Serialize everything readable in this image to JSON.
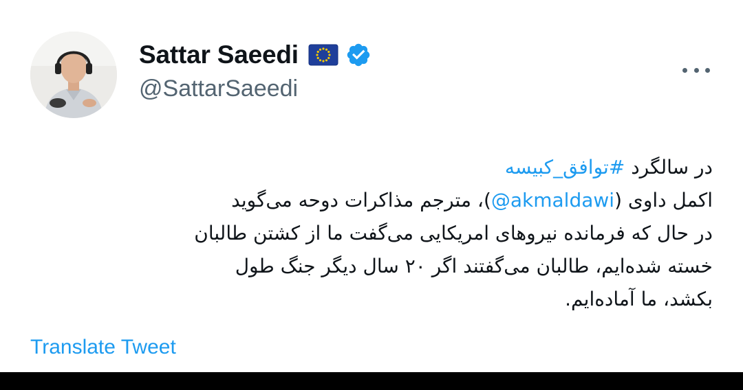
{
  "author": {
    "display_name": "Sattar Saeedi",
    "handle": "@SattarSaeedi",
    "flag_icon": "eu-flag-icon",
    "verified_icon": "verified-badge-icon"
  },
  "menu": {
    "icon": "more-options-icon"
  },
  "tweet": {
    "line1": {
      "text": "در سالگرد ",
      "hashtag": "#توافق_کبیسه"
    },
    "line2": {
      "before": "اکمل داوی (",
      "mention": "@akmaldawi",
      "after": ")، مترجم مذاکرات دوحه می‌گوید"
    },
    "line3": "در حال که فرمانده نیروهای امریکایی می‌گفت ما از کشتن طالبان",
    "line4": "خسته شده‌ایم، طالبان می‌گفتند اگر ۲۰ سال دیگر جنگ طول",
    "line5": "بکشد، ما آماده‌ایم."
  },
  "translate_label": "Translate Tweet",
  "colors": {
    "link": "#1d9bf0",
    "secondary": "#536471",
    "text": "#0f1419"
  }
}
